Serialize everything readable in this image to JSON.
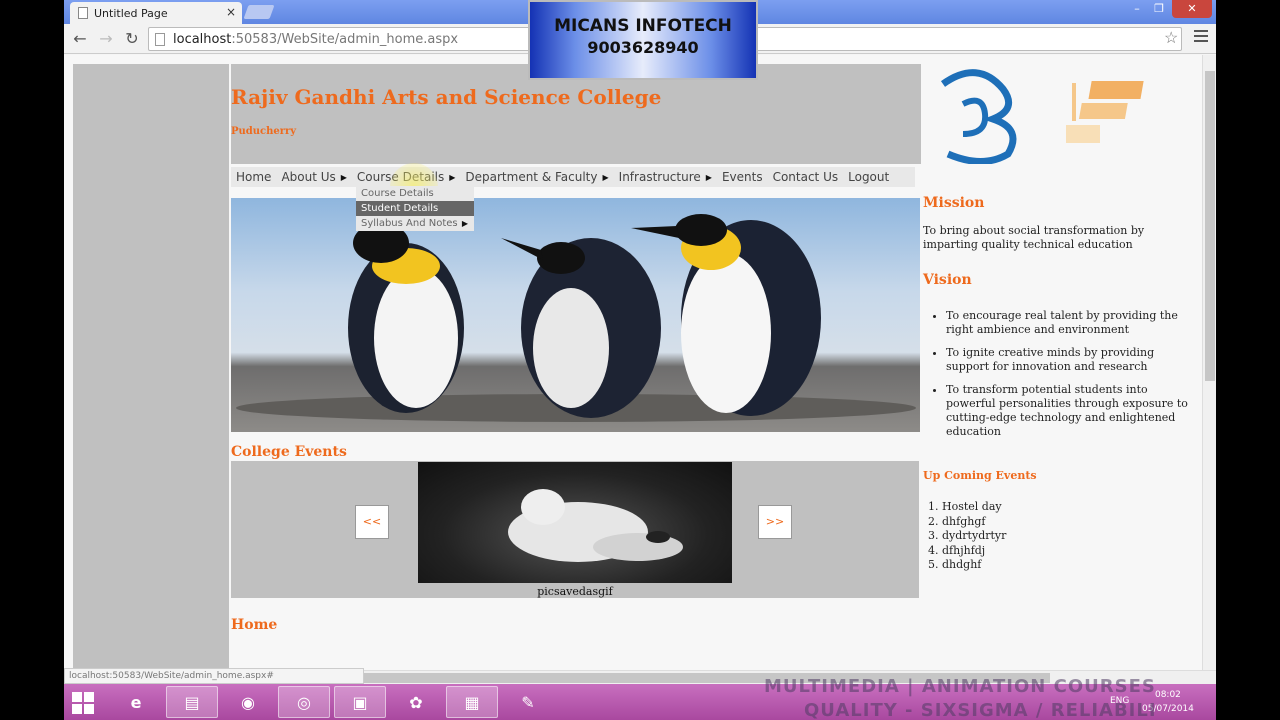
{
  "browser": {
    "tab_title": "Untitled Page",
    "tab_close": "×",
    "url_host": "localhost",
    "url_path": ":50583/WebSite/admin_home.aspx",
    "win_min": "–",
    "win_max": "❐",
    "win_close": "✕"
  },
  "banner": {
    "line1": "MICANS INFOTECH",
    "line2": "9003628940"
  },
  "site": {
    "title": "Rajiv Gandhi Arts and Science College",
    "city": "Puducherry"
  },
  "menu": [
    {
      "label": "Home",
      "has_sub": false
    },
    {
      "label": "About Us",
      "has_sub": true
    },
    {
      "label": "Course Details",
      "has_sub": true
    },
    {
      "label": "Department & Faculty",
      "has_sub": true
    },
    {
      "label": "Infrastructure",
      "has_sub": true
    },
    {
      "label": "Events",
      "has_sub": false
    },
    {
      "label": "Contact Us",
      "has_sub": false
    },
    {
      "label": "Logout",
      "has_sub": false
    }
  ],
  "submenu": [
    {
      "label": "Course Details"
    },
    {
      "label": "Student Details"
    },
    {
      "label": "Syllabus And Notes"
    }
  ],
  "events": {
    "title": "College Events",
    "prev": "<<",
    "next": ">>",
    "caption": "picsavedasgif"
  },
  "home_link": "Home",
  "mission": {
    "heading": "Mission",
    "text": "To bring about social transformation by imparting quality technical education"
  },
  "vision": {
    "heading": "Vision",
    "items": [
      "To encourage real talent by providing the right ambience and environment",
      "To ignite creative minds by providing support for innovation and research",
      "To transform potential students into powerful personalities through exposure to cutting-edge technology and enlightened education"
    ]
  },
  "upcoming": {
    "heading": "Up Coming Events",
    "items": [
      "Hostel day",
      "dhfghgf",
      "dydrtydrtyr",
      "dfhjhfdj",
      "dhdghf"
    ]
  },
  "status_text": "localhost:50583/WebSite/admin_home.aspx#",
  "taskbar": {
    "tray_lang": "ENG",
    "time": "08:02",
    "date": "05/07/2014",
    "overlay1": "MULTIMEDIA | ANIMATION COURSES",
    "overlay2": "QUALITY - SIXSIGMA / RELIABILI"
  },
  "colors": {
    "accent": "#ee6a1d",
    "panel": "#c0c0c0"
  }
}
